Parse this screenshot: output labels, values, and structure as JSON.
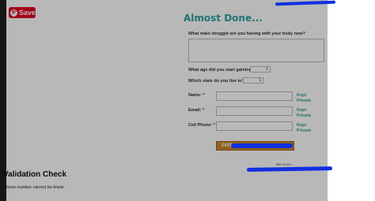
{
  "pin_button": {
    "label": "Save",
    "logo": "P"
  },
  "form": {
    "title": "Almost Done...",
    "q_struggle": "What main struggle are you having with your body now?",
    "q_age": "What age did you start gaining? *:",
    "age_value": "1",
    "q_state": "Which state do you live in? *:",
    "state_value": "1",
    "name_label": "Name: *",
    "email_label": "Email: *",
    "phone_label": "Cell Phone: *",
    "kept_private": "Kept\nPrivate",
    "submit_label": "GIVE",
    "privacy_note": "We never..."
  },
  "validation": {
    "title": "Validation Check",
    "message": "Phone number cannot be blank."
  },
  "colors": {
    "accent": "#2e9fa3",
    "pinterest": "#e60023",
    "button": "#c78a2b",
    "redaction": "#1030e0"
  }
}
